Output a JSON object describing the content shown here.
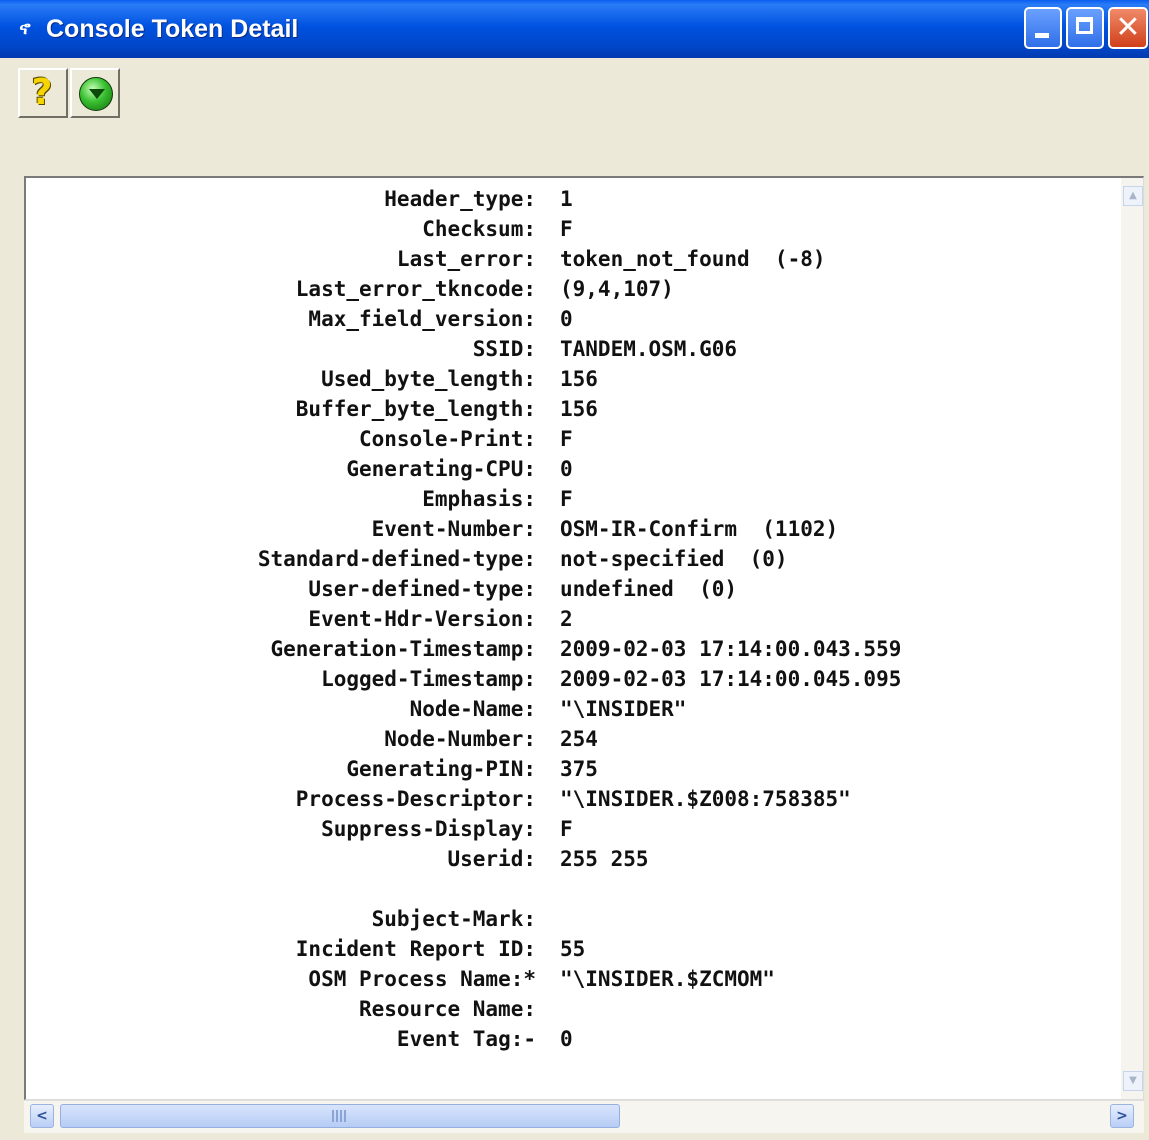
{
  "window": {
    "title": "Console Token Detail"
  },
  "icons": {
    "app": "app-icon",
    "help": "help-icon",
    "go": "go-icon"
  },
  "fields": [
    {
      "label": "Header_type:",
      "value": "1"
    },
    {
      "label": "Checksum:",
      "value": "F"
    },
    {
      "label": "Last_error:",
      "value": "token_not_found  (-8)"
    },
    {
      "label": "Last_error_tkncode:",
      "value": "(9,4,107)"
    },
    {
      "label": "Max_field_version:",
      "value": "0"
    },
    {
      "label": "SSID:",
      "value": "TANDEM.OSM.G06"
    },
    {
      "label": "Used_byte_length:",
      "value": "156"
    },
    {
      "label": "Buffer_byte_length:",
      "value": "156"
    },
    {
      "label": "Console-Print:",
      "value": "F"
    },
    {
      "label": "Generating-CPU:",
      "value": "0"
    },
    {
      "label": "Emphasis:",
      "value": "F"
    },
    {
      "label": "Event-Number:",
      "value": "OSM-IR-Confirm  (1102)"
    },
    {
      "label": "Standard-defined-type:",
      "value": "not-specified  (0)"
    },
    {
      "label": "User-defined-type:",
      "value": "undefined  (0)"
    },
    {
      "label": "Event-Hdr-Version:",
      "value": "2"
    },
    {
      "label": "Generation-Timestamp:",
      "value": "2009-02-03 17:14:00.043.559"
    },
    {
      "label": "Logged-Timestamp:",
      "value": "2009-02-03 17:14:00.045.095"
    },
    {
      "label": "Node-Name:",
      "value": "\"\\INSIDER\""
    },
    {
      "label": "Node-Number:",
      "value": "254"
    },
    {
      "label": "Generating-PIN:",
      "value": "375"
    },
    {
      "label": "Process-Descriptor:",
      "value": "\"\\INSIDER.$Z008:758385\""
    },
    {
      "label": "Suppress-Display:",
      "value": "F"
    },
    {
      "label": "Userid:",
      "value": "255 255"
    },
    {
      "label": "",
      "value": ""
    },
    {
      "label": "Subject-Mark:",
      "value": ""
    },
    {
      "label": "Incident Report ID:",
      "value": "55"
    },
    {
      "label": "OSM Process Name:*",
      "value": "\"\\INSIDER.$ZCMOM\""
    },
    {
      "label": "Resource Name:",
      "value": ""
    },
    {
      "label": "Event Tag:-",
      "value": "0"
    }
  ]
}
